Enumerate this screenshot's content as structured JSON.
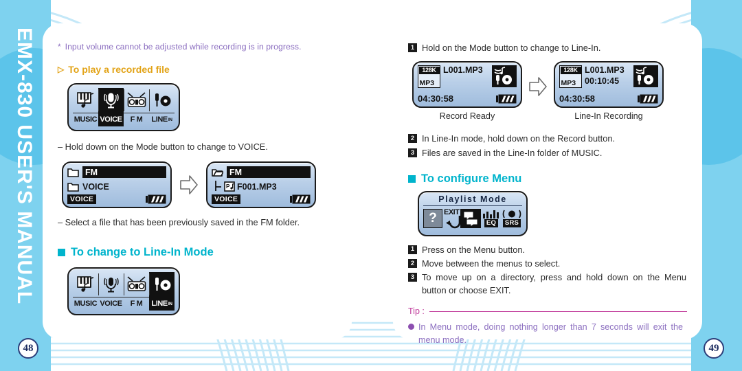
{
  "sidebars": {
    "title": "EMX-830 USER'S MANUAL",
    "left_page_number": "48",
    "right_page_number": "49"
  },
  "left_page": {
    "note": {
      "marker": "*",
      "text": "Input volume cannot be adjusted while recording is in progress."
    },
    "heading_play": {
      "marker": "▷",
      "text": "To play a recorded file"
    },
    "mode_strip_1": {
      "name": "mode-selection-display",
      "cells": [
        {
          "label": "MUSIC",
          "icon": "piano-icon",
          "selected": false
        },
        {
          "label": "VOICE",
          "icon": "microphone-icon",
          "selected": true
        },
        {
          "label": "F M",
          "icon": "radio-icon",
          "selected": false
        },
        {
          "label": "LINE",
          "sublabel": "IN",
          "icon": "line-in-icon",
          "selected": false
        }
      ]
    },
    "instruction_1": "– Hold down on the Mode button to change to VOICE.",
    "lcd_before": {
      "row1": {
        "icon": "folder-closed-icon",
        "label": "FM",
        "highlighted": true
      },
      "row2": {
        "icon": "folder-closed-icon",
        "label": "VOICE",
        "highlighted": false
      },
      "status_tag": "VOICE",
      "battery": "battery-full-icon"
    },
    "lcd_after": {
      "row1": {
        "icon": "folder-open-icon",
        "label": "FM",
        "highlighted": true
      },
      "row2": {
        "icon": "mp3-file-icon",
        "label": "F001.MP3",
        "highlighted": false
      },
      "status_tag": "VOICE",
      "battery": "battery-full-icon"
    },
    "instruction_2": "– Select a file that has been previously saved in the FM folder.",
    "heading_linein": "To change to Line-In Mode",
    "mode_strip_2": {
      "name": "mode-selection-display",
      "cells": [
        {
          "label": "MUSIC",
          "icon": "piano-icon",
          "selected": false
        },
        {
          "label": "VOICE",
          "icon": "microphone-icon",
          "selected": false
        },
        {
          "label": "F M",
          "icon": "radio-icon",
          "selected": false
        },
        {
          "label": "LINE",
          "sublabel": "IN",
          "icon": "line-in-icon",
          "selected": true
        }
      ]
    }
  },
  "right_page": {
    "step_1": {
      "number": "1",
      "text": "Hold on the Mode button to change to Line-In."
    },
    "lcd_record_ready": {
      "codec_bitrate": "128K",
      "codec_format": "MP3",
      "track": "L001.MP3",
      "elapsed": "",
      "total_time": "04:30:58",
      "mode_icon": "line-in-icon",
      "battery": "battery-full-icon",
      "caption": "Record Ready"
    },
    "lcd_line_in_recording": {
      "codec_bitrate": "128K",
      "codec_format": "MP3",
      "track": "L001.MP3",
      "elapsed": "00:10:45",
      "total_time": "04:30:58",
      "mode_icon": "line-in-icon",
      "battery": "battery-full-icon",
      "caption": "Line-In Recording"
    },
    "step_2": {
      "number": "2",
      "text": "In Line-In mode, hold down on the Record button."
    },
    "step_3": {
      "number": "3",
      "text": "Files are saved in the Line-In folder of MUSIC."
    },
    "heading_menu": "To configure Menu",
    "lcd_menu": {
      "title": "Playlist Mode",
      "icons": [
        {
          "name": "question-mark-icon",
          "label": "?"
        },
        {
          "name": "exit-icon",
          "label": "EXIT"
        },
        {
          "name": "playlist-icon",
          "label": ""
        },
        {
          "name": "equalizer-icon",
          "label": "EQ"
        },
        {
          "name": "srs-icon",
          "label": "SRS"
        }
      ]
    },
    "menu_step_1": {
      "number": "1",
      "text": "Press on the Menu button."
    },
    "menu_step_2": {
      "number": "2",
      "text": "Move between the menus to select."
    },
    "menu_step_3": {
      "number": "3",
      "text": "To move up on a directory, press and hold down on the Menu button or choose EXIT."
    },
    "tip": {
      "label": "Tip :",
      "text": "In Menu mode, doing nothing longer than 7 seconds will exit the menu mode."
    }
  },
  "colors": {
    "heading_teal": "#00b4cc",
    "heading_amber": "#e2a317",
    "note_purple": "#8c6fc0",
    "tip_magenta": "#c0399a",
    "sidebar_blue": "#7ed2ef",
    "arc_blue": "#bfe6f7"
  }
}
